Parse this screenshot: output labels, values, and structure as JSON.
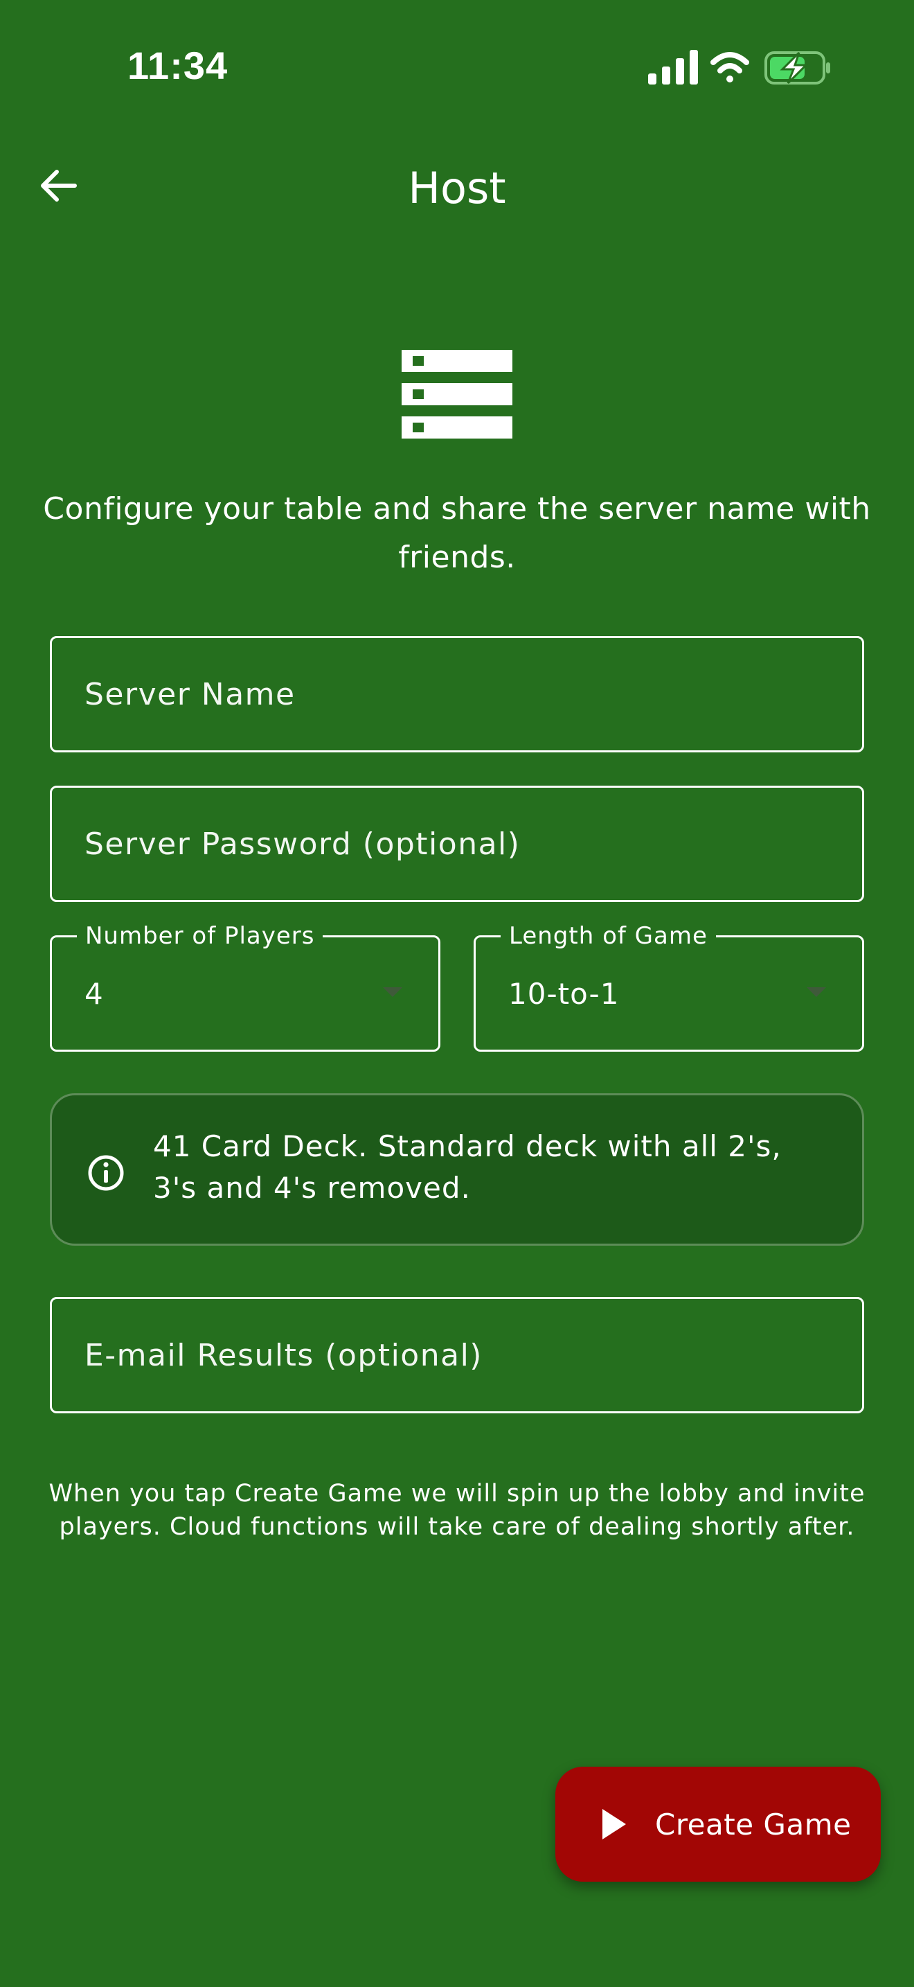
{
  "status_bar": {
    "time": "11:34",
    "icons": [
      "signal-icon",
      "wifi-icon",
      "battery-charging-icon"
    ]
  },
  "app_bar": {
    "back_icon": "arrow-back-icon",
    "title": "Host"
  },
  "hero": {
    "icon": "server-icon",
    "intro_text": "Configure your table and share the server name with friends."
  },
  "form": {
    "server_name": {
      "placeholder": "Server Name",
      "value": ""
    },
    "server_password": {
      "placeholder": "Server Password (optional)",
      "value": ""
    },
    "num_players": {
      "label": "Number of Players",
      "value": "4"
    },
    "game_length": {
      "label": "Length of Game",
      "value": "10-to-1"
    },
    "email_results": {
      "placeholder": "E-mail Results (optional)",
      "value": ""
    }
  },
  "info_card": {
    "icon": "info-icon",
    "text": "41 Card Deck. Standard deck with all 2's, 3's and 4's removed."
  },
  "footnote": "When you tap Create Game we will spin up the lobby and invite players. Cloud functions will take care of dealing shortly after.",
  "fab": {
    "icon": "play-icon",
    "label": "Create Game"
  },
  "colors": {
    "background": "#256f1e",
    "card_background": "#1d5a19",
    "fab_background": "#a20605",
    "battery_accent": "#4cd964"
  }
}
